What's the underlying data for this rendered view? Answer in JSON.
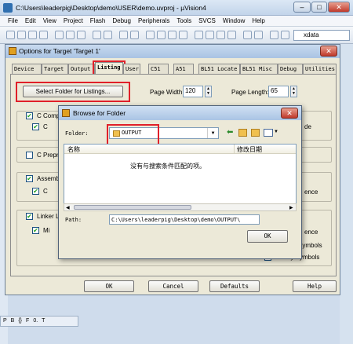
{
  "app": {
    "title": "C:\\Users\\leaderpig\\Desktop\\demo\\USER\\demo.uvproj - µVision4",
    "menus": [
      "File",
      "Edit",
      "View",
      "Project",
      "Flash",
      "Debug",
      "Peripherals",
      "Tools",
      "SVCS",
      "Window",
      "Help"
    ],
    "toolbar_search": "xdata",
    "bottom_tabs": [
      "P",
      "B",
      "{}",
      "F",
      "0.",
      "T"
    ]
  },
  "options": {
    "title": "Options for Target 'Target 1'",
    "tabs": [
      "Device",
      "Target",
      "Output",
      "Listing",
      "User",
      "C51",
      "A51",
      "BL51 Locate",
      "BL51 Misc",
      "Debug",
      "Utilities"
    ],
    "active_tab": "Listing",
    "select_folder_label": "Select Folder for Listings...",
    "page_width_label": "Page Width:",
    "page_width_value": "120",
    "page_length_label": "Page Length:",
    "page_length_value": "65",
    "c_compiler_label": "C Comp",
    "c_compiler_sub": "C",
    "c_compiler_right": "de",
    "c_preprocessor_label": "C Prepr",
    "assembler_label": "Assemb",
    "assembler_sub": "C",
    "assembler_right": "ence",
    "linker_label": "Linker Li",
    "linker_sub": "Mi",
    "linker_right_1": "ence",
    "linker_right_2": "Symbols",
    "library_symbols": "Library Symbols",
    "ok_label": "OK",
    "cancel_label": "Cancel",
    "defaults_label": "Defaults",
    "help_label": "Help"
  },
  "browse": {
    "title": "Browse for Folder",
    "folder_label": "Folder:",
    "folder_value": "OUTPUT",
    "col_name": "名称",
    "col_modified": "修改日期",
    "empty_text": "没有与搜索条件匹配的项。",
    "path_label": "Path:",
    "path_value": "C:\\Users\\leaderpig\\Desktop\\demo\\OUTPUT\\",
    "ok_label": "OK"
  },
  "colors": {
    "highlight": "#e0202a",
    "check": "#21a121"
  }
}
